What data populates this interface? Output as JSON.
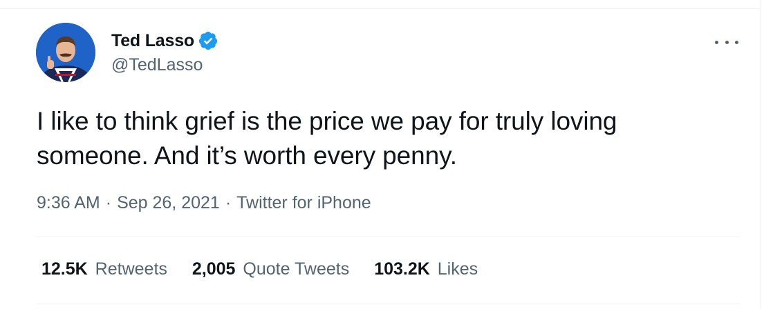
{
  "tweet": {
    "author": {
      "display_name": "Ted Lasso",
      "handle": "@TedLasso",
      "verified": true,
      "verified_icon": "verified-badge-icon",
      "avatar_icon": "profile-avatar"
    },
    "more_icon": "more-options-icon",
    "text": "I like to think grief is the price we pay for truly loving someone. And it’s worth every penny.",
    "meta": {
      "time": "9:36 AM",
      "separator": "·",
      "date": "Sep 26, 2021",
      "source": "Twitter for iPhone"
    },
    "stats": {
      "retweets_count": "12.5K",
      "retweets_label": "Retweets",
      "quote_tweets_count": "2,005",
      "quote_tweets_label": "Quote Tweets",
      "likes_count": "103.2K",
      "likes_label": "Likes"
    }
  },
  "colors": {
    "text_primary": "#0f1419",
    "text_secondary": "#536471",
    "verified_blue": "#1d9bf0",
    "divider": "#eff3f4",
    "avatar_bg": "#1f63c8"
  }
}
